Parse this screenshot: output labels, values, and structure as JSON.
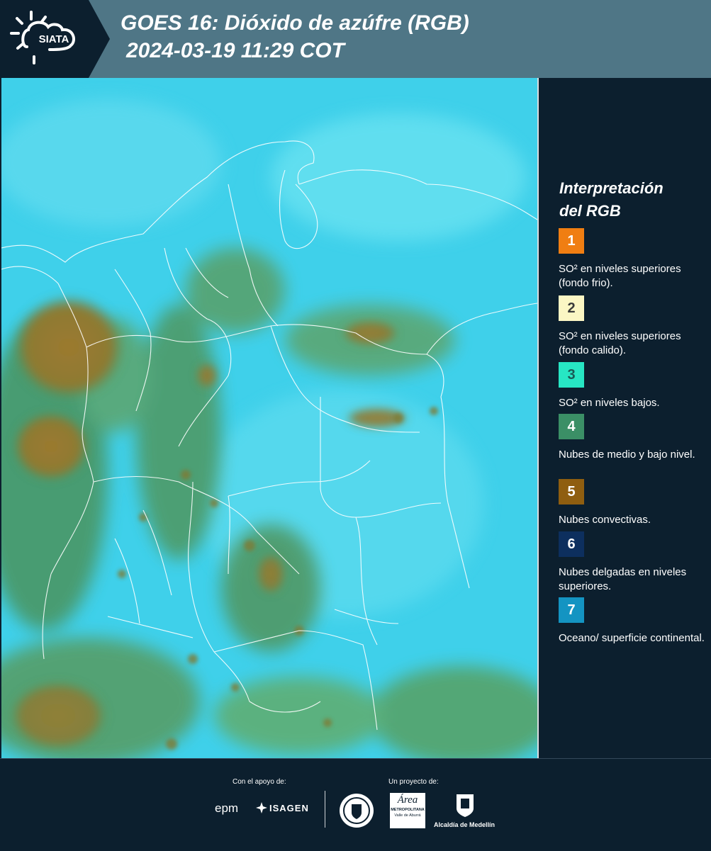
{
  "header": {
    "logo_text": "SIATA",
    "title_line1": "GOES 16: Dióxido de azúfre (RGB)",
    "title_line2": "2024-03-19 11:29 COT"
  },
  "legend": {
    "title_line1": "Interpretación",
    "title_line2": "del RGB",
    "items": [
      {
        "number": "1",
        "description": "SO² en niveles superiores (fondo frio).",
        "color": "#f07e12"
      },
      {
        "number": "2",
        "description": "SO² en niveles superiores (fondo calido).",
        "color": "#fbf6c4"
      },
      {
        "number": "3",
        "description": "SO² en niveles bajos.",
        "color": "#27e6c4"
      },
      {
        "number": "4",
        "description": "Nubes de medio y bajo nivel.",
        "color": "#3b8f66"
      },
      {
        "number": "5",
        "description": "Nubes convectivas.",
        "color": "#8f5e10"
      },
      {
        "number": "6",
        "description": "Nubes delgadas en niveles superiores.",
        "color": "#0d2f5e"
      },
      {
        "number": "7",
        "description": "Oceano/ superficie continental.",
        "color": "#1494c2"
      }
    ]
  },
  "footer": {
    "support_caption": "Con el apoyo de:",
    "project_caption": "Un proyecto de:",
    "logo_epm": "epm",
    "logo_isagen": "ISAGEN",
    "logo_area_line1": "Área",
    "logo_area_line2": "METROPOLITANA",
    "logo_area_line3": "Valle de Aburrá",
    "logo_alcaldia": "Alcaldía de Medellín"
  },
  "colors": {
    "header_bg": "#4f7686",
    "dark_bg": "#0c1f2e",
    "map_cyan": "#3ccfea",
    "map_green": "#4f9a6a",
    "map_brown": "#9a7a2c"
  }
}
